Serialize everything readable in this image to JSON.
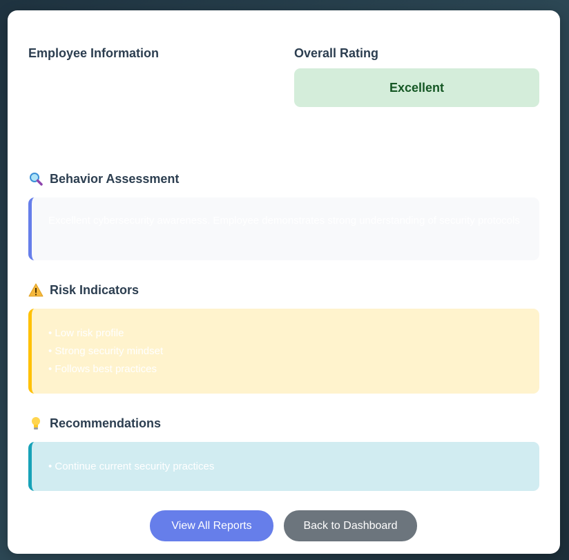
{
  "employee_info": {
    "title": "Employee Information"
  },
  "overall_rating": {
    "title": "Overall Rating",
    "value": "Excellent"
  },
  "behavior": {
    "title": "Behavior Assessment",
    "icon": "magnifier-icon",
    "text": "Excellent cybersecurity awareness. Employee demonstrates strong understanding of security protocols"
  },
  "risk": {
    "title": "Risk Indicators",
    "icon": "warning-icon",
    "items": [
      "Low risk profile",
      "Strong security mindset",
      "Follows best practices"
    ]
  },
  "recommendations": {
    "title": "Recommendations",
    "icon": "lightbulb-icon",
    "items": [
      "Continue current security practices"
    ]
  },
  "buttons": {
    "view_reports": "View All Reports",
    "back_dashboard": "Back to Dashboard"
  },
  "colors": {
    "primary": "#667eea",
    "secondary": "#6c757d",
    "rating_bg": "#d4edda",
    "rating_text": "#155724",
    "risk_accent": "#ffc107",
    "rec_accent": "#17a2b8"
  }
}
